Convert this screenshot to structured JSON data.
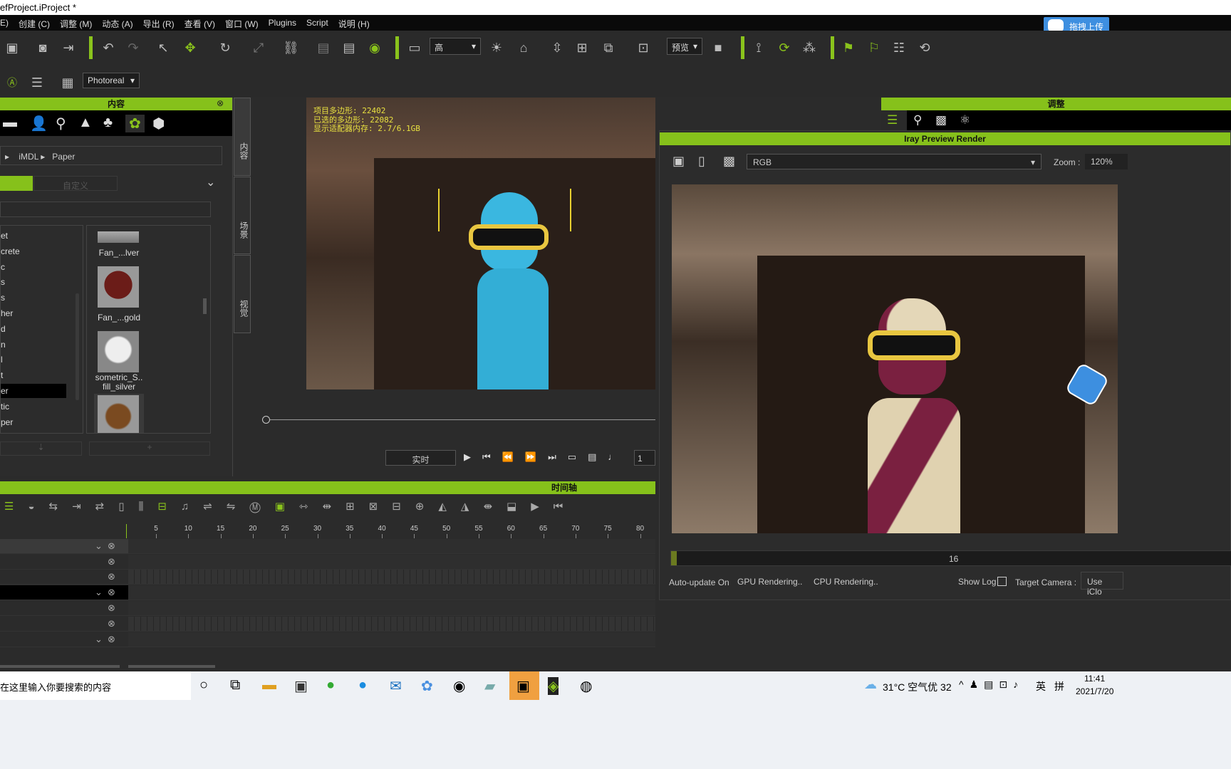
{
  "window": {
    "title": "efProject.iProject *"
  },
  "menu": [
    "E)",
    "创建 (C)",
    "调整 (M)",
    "动态 (A)",
    "导出 (R)",
    "查看 (V)",
    "窗口 (W)",
    "Plugins",
    "Script",
    "说明 (H)"
  ],
  "upload_button": "拖拽上传",
  "toolbar": {
    "quality_select": "高",
    "preview_select": "预览",
    "render_mode": "Photoreal"
  },
  "content_panel": {
    "title": "内容",
    "breadcrumb": [
      "iMDL",
      "Paper"
    ],
    "tabs": [
      "",
      "自定义"
    ],
    "folders": [
      "et",
      "crete",
      "c",
      "s",
      "s",
      "her",
      "d",
      "n",
      "l",
      "t",
      "er",
      "tic",
      "per"
    ],
    "selected_folder_index": 10,
    "items": [
      {
        "label": "Fan_...lver"
      },
      {
        "label": "Fan_...gold"
      },
      {
        "label": "sometric_S..\nfill_silver"
      },
      {
        "label": ""
      }
    ]
  },
  "side_tabs": [
    "内容",
    "场景",
    "视觉"
  ],
  "viewport": {
    "stats": [
      "项目多边形: 22402",
      "已选的多边形: 22082",
      "显示适配器内存: 2.7/6.1GB"
    ]
  },
  "playback": {
    "mode": "实时",
    "frame": "1"
  },
  "timeline": {
    "title": "时间轴",
    "ticks": [
      "5",
      "10",
      "15",
      "20",
      "25",
      "30",
      "35",
      "40",
      "45",
      "50",
      "55",
      "60",
      "65",
      "70",
      "75",
      "80"
    ]
  },
  "adjust_panel": {
    "title": "调整"
  },
  "iray": {
    "title": "Iray Preview Render",
    "channel": "RGB",
    "zoom_label": "Zoom :",
    "zoom": "120%",
    "progress_label": "16",
    "progress": 0.01,
    "auto_update": "Auto-update On",
    "gpu": "GPU Rendering..",
    "cpu": "CPU Rendering..",
    "show_log": "Show Log",
    "target_camera_label": "Target Camera :",
    "target_camera": "Use iClo"
  },
  "taskbar": {
    "search": "在这里输入你要搜索的内容",
    "weather": "31°C 空气优 32",
    "ime1": "英",
    "ime2": "拼",
    "time": "11:41",
    "date": "2021/7/20"
  },
  "colors": {
    "accent": "#86c11b",
    "background": "#2b2b2b"
  }
}
